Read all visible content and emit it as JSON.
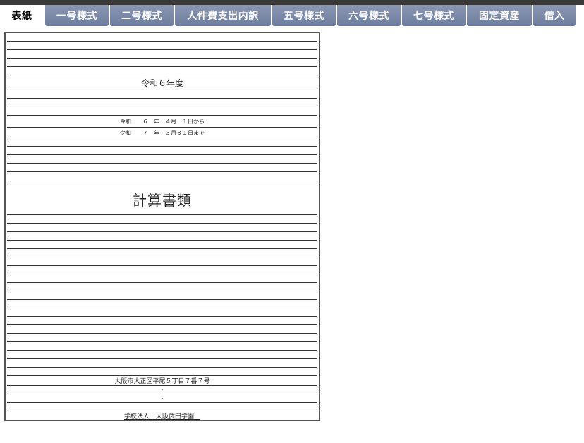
{
  "tabs": [
    {
      "label": "表紙",
      "active": true
    },
    {
      "label": "一号様式",
      "active": false
    },
    {
      "label": "二号様式",
      "active": false
    },
    {
      "label": "人件費支出内訳",
      "active": false
    },
    {
      "label": "五号様式",
      "active": false
    },
    {
      "label": "六号様式",
      "active": false
    },
    {
      "label": "七号様式",
      "active": false
    },
    {
      "label": "固定資産",
      "active": false
    },
    {
      "label": "借入",
      "active": false
    }
  ],
  "cover": {
    "fiscal_year": "令和６年度",
    "period_start": "令和　　６　年　４月　１日から",
    "period_end": "令和　　７　年　３月３１日まで",
    "title": "計算書類",
    "address": "大阪市大正区平尾５丁目７番７号",
    "dash_1": "-",
    "dash_2": "-",
    "organization": "学校法人　大阪武田学園　"
  }
}
